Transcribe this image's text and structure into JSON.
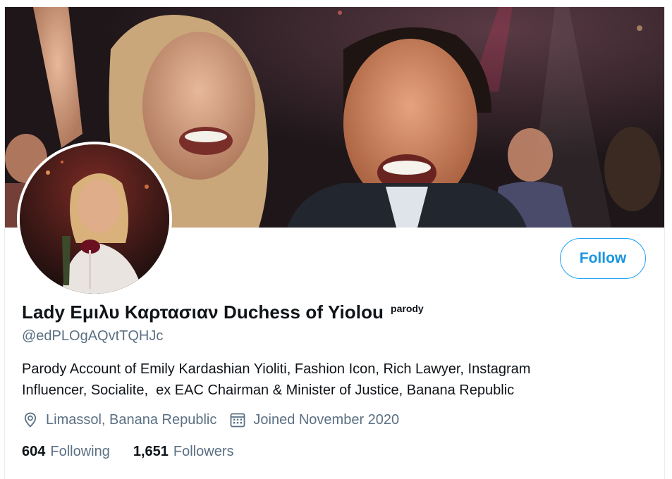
{
  "profile": {
    "display_name": "Lady Εμιλυ Καρτασιαν Duchess of Yiolou",
    "badge": "parody",
    "handle": "@edPLOgAQvtTQHJc",
    "bio_lines": [
      "Parody Account of Emily Kardashian Yioliti, Fashion Icon, Rich Lawyer, Instagram",
      "Influencer, Socialite,  ex EAC Chairman & Minister of Justice, Banana Republic"
    ],
    "location": "Limassol, Banana Republic",
    "joined": "Joined November 2020",
    "following_count": "604",
    "following_label": "Following",
    "followers_count": "1,651",
    "followers_label": "Followers"
  },
  "actions": {
    "follow_label": "Follow"
  },
  "icons": {
    "location": "location-pin-icon",
    "joined": "calendar-icon"
  },
  "colors": {
    "accent": "#1da1f2",
    "accent_text": "#1b95e0",
    "secondary_text": "#5b7083",
    "primary_text": "#0f1419"
  }
}
